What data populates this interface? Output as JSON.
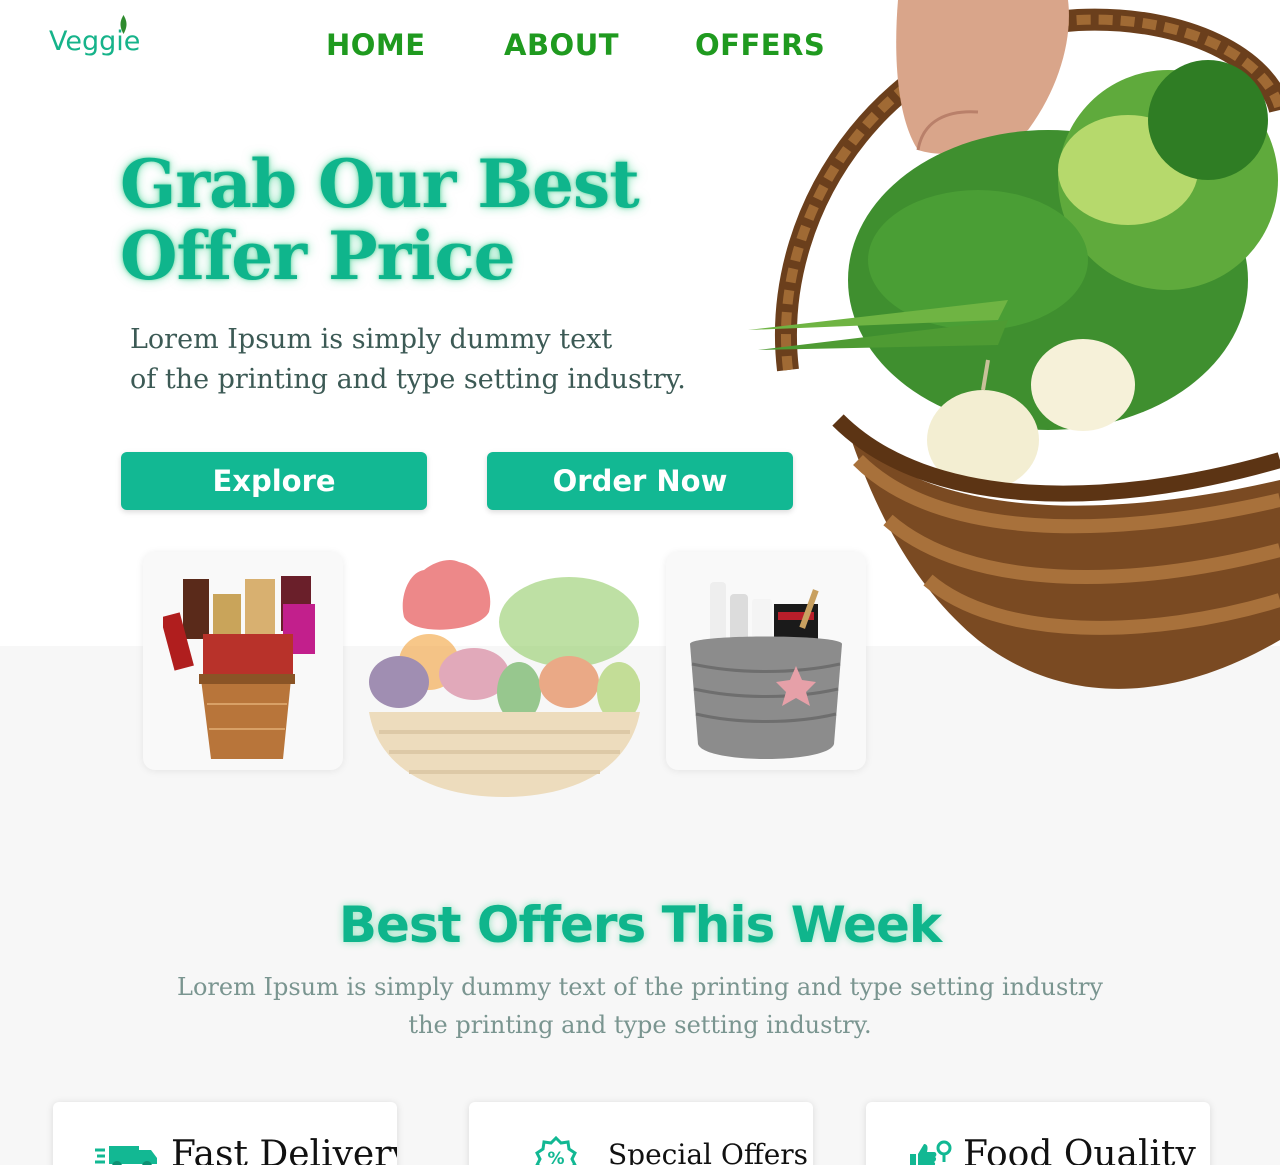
{
  "brand": {
    "name": "Veggie"
  },
  "nav": {
    "items": [
      {
        "label": "HOME"
      },
      {
        "label": "ABOUT"
      },
      {
        "label": "OFFERS"
      }
    ]
  },
  "hero": {
    "title_line1": "Grab Our Best",
    "title_line2": "Offer Price",
    "subtitle_line1": "Lorem Ipsum is simply dummy text",
    "subtitle_line2": "of the printing and type setting industry.",
    "explore_label": "Explore",
    "order_label": "Order Now"
  },
  "offers": {
    "title": "Best Offers This Week",
    "desc_line1": "Lorem Ipsum is simply dummy text of the printing and type setting industry",
    "desc_line2": "the printing and type setting industry."
  },
  "features": [
    {
      "label": "Fast Delivery",
      "icon": "delivery-truck-icon"
    },
    {
      "label": "Special Offers",
      "icon": "percent-badge-icon"
    },
    {
      "label": "Food Quality",
      "icon": "quality-thumb-icon"
    }
  ],
  "colors": {
    "accent": "#12b893",
    "nav": "#1f9a1f",
    "title": "#0fb58c"
  }
}
